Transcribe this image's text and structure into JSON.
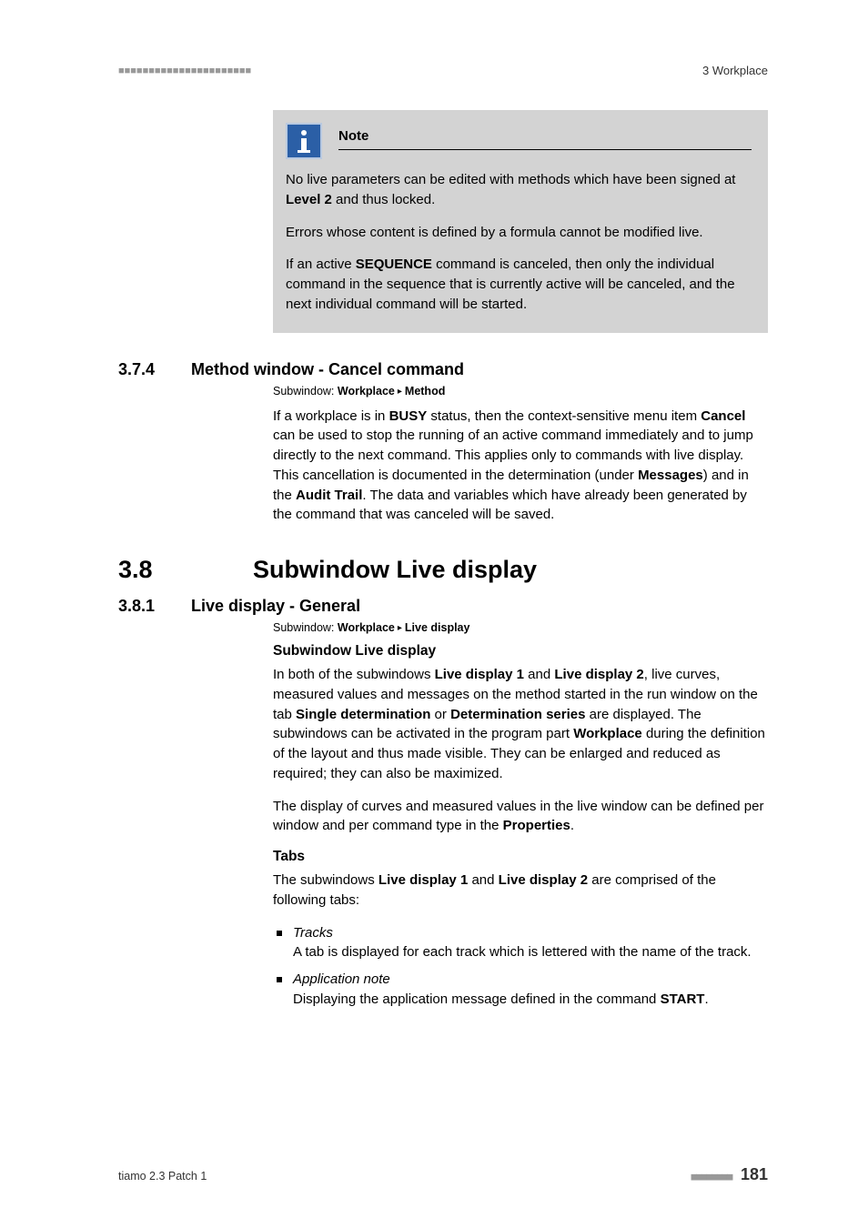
{
  "header": {
    "dashes": "■■■■■■■■■■■■■■■■■■■■■■",
    "chapter": "3 Workplace"
  },
  "note": {
    "title": "Note",
    "p1a": "No live parameters can be edited with methods which have been signed at ",
    "p1b": "Level 2",
    "p1c": " and thus locked.",
    "p2": "Errors whose content is defined by a formula cannot be modified live.",
    "p3a": "If an active ",
    "p3b": "SEQUENCE",
    "p3c": " command is canceled, then only the individual command in the sequence that is currently active will be canceled, and the next individual command will be started."
  },
  "s374": {
    "num": "3.7.4",
    "title": "Method window - Cancel command",
    "sub_prefix": "Subwindow: ",
    "sub_a": "Workplace",
    "sub_b": "Method",
    "p1a": "If a workplace is in ",
    "p1b": "BUSY",
    "p1c": " status, then the context-sensitive menu item ",
    "p1d": "Cancel",
    "p1e": " can be used to stop the running of an active command immediately and to jump directly to the next command. This applies only to commands with live display. This cancellation is documented in the determination (under ",
    "p1f": "Messages",
    "p1g": ") and in the ",
    "p1h": "Audit Trail",
    "p1i": ". The data and variables which have already been generated by the command that was canceled will be saved."
  },
  "s38": {
    "num": "3.8",
    "title": "Subwindow Live display"
  },
  "s381": {
    "num": "3.8.1",
    "title": "Live display - General",
    "sub_prefix": "Subwindow: ",
    "sub_a": "Workplace",
    "sub_b": "Live display",
    "h_sub": "Subwindow Live display",
    "p1a": "In both of the subwindows ",
    "p1b": "Live display 1",
    "p1c": " and ",
    "p1d": "Live display 2",
    "p1e": ", live curves, measured values and messages on the method started in the run window on the tab ",
    "p1f": "Single determination",
    "p1g": " or ",
    "p1h": "Determination series",
    "p1i": " are displayed. The subwindows can be activated in the program part ",
    "p1j": "Workplace",
    "p1k": " during the definition of the layout and thus made visible. They can be enlarged and reduced as required; they can also be maximized.",
    "p2a": "The display of curves and measured values in the live window can be defined per window and per command type in the ",
    "p2b": "Properties",
    "p2c": ".",
    "h_tabs": "Tabs",
    "tabs_intro_a": "The subwindows ",
    "tabs_intro_b": "Live display 1",
    "tabs_intro_c": " and ",
    "tabs_intro_d": "Live display 2",
    "tabs_intro_e": " are comprised of the following tabs:",
    "li1_t": "Tracks",
    "li1_b": "A tab is displayed for each track which is lettered with the name of the track.",
    "li2_t": "Application note",
    "li2_ba": "Displaying the application message defined in the command ",
    "li2_bb": "START",
    "li2_bc": "."
  },
  "footer": {
    "product": "tiamo 2.3 Patch 1",
    "marks": "■■■■■■■■",
    "page": "181"
  }
}
